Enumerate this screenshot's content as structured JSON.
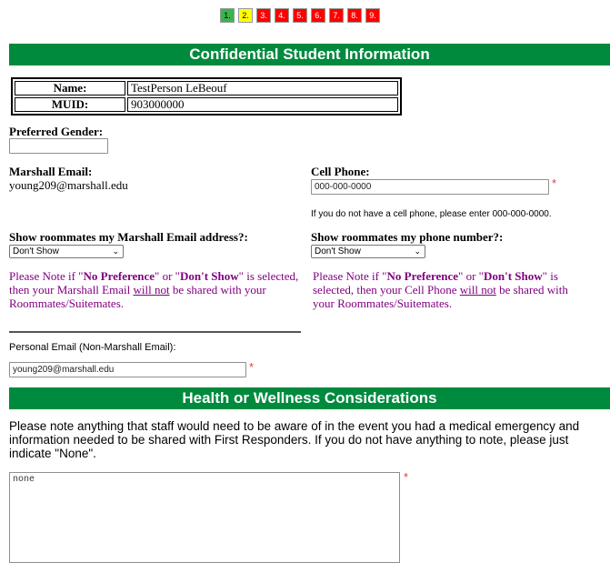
{
  "steps": [
    {
      "label": "1.",
      "color": "green"
    },
    {
      "label": "2.",
      "color": "yellow"
    },
    {
      "label": "3.",
      "color": "red"
    },
    {
      "label": "4.",
      "color": "red"
    },
    {
      "label": "5.",
      "color": "red"
    },
    {
      "label": "6.",
      "color": "red"
    },
    {
      "label": "7.",
      "color": "red"
    },
    {
      "label": "8.",
      "color": "red"
    },
    {
      "label": "9.",
      "color": "red"
    }
  ],
  "section1_title": "Confidential Student Information",
  "student": {
    "name_label": "Name:",
    "name_value": "TestPerson LeBeouf",
    "muid_label": "MUID:",
    "muid_value": "903000000"
  },
  "preferred_gender": {
    "label": "Preferred Gender:",
    "value": ""
  },
  "marshall_email": {
    "label": "Marshall Email:",
    "value": "young209@marshall.edu"
  },
  "cell_phone": {
    "label": "Cell Phone:",
    "value": "000-000-0000",
    "hint": "If you do not have a cell phone, please enter 000-000-0000.",
    "required_mark": "*"
  },
  "show_email": {
    "label": "Show roommates my Marshall Email address?:",
    "selected": "Don't Show"
  },
  "show_phone": {
    "label": "Show roommates my phone number?:",
    "selected": "Don't Show"
  },
  "email_note": {
    "pre": "Please Note if \"",
    "opt1": "No Preference",
    "mid": "\" or \"",
    "opt2": "Don't Show",
    "post1": "\" is selected, then your Marshall Email ",
    "willnot": "will not",
    "post2": " be shared with your Roommates/Suitemates."
  },
  "phone_note": {
    "pre": "Please Note if \"",
    "opt1": "No Preference",
    "mid": "\" or \"",
    "opt2": "Don't Show",
    "post1": "\" is selected, then your Cell Phone ",
    "willnot": "will not",
    "post2": " be shared with your Roommates/Suitemates."
  },
  "personal_email": {
    "label": "Personal Email (Non-Marshall Email):",
    "value": "young209@marshall.edu",
    "required_mark": "*"
  },
  "section2_title": "Health or Wellness Considerations",
  "health": {
    "instructions": "Please note anything that staff would need to be aware of in the event you had a medical emergency and information needed to be shared with First Responders. If you do not have anything to note, please just indicate \"None\".",
    "value": "none",
    "required_mark": "*"
  },
  "colors": {
    "header_green": "#008a3e",
    "note_purple": "#800080",
    "required_red": "#e04040"
  }
}
